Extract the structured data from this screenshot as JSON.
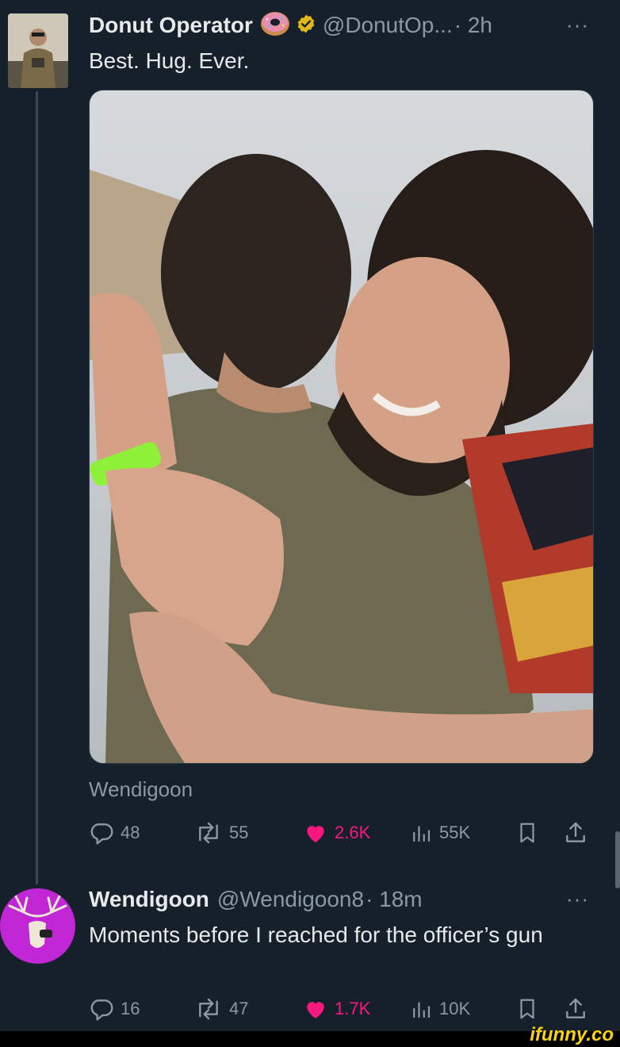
{
  "tweet1": {
    "display_name": "Donut Operator",
    "name_emoji": "donut-icon",
    "verified": true,
    "handle": "@DonutOp...",
    "time": "· 2h",
    "more": "···",
    "text": "Best. Hug. Ever.",
    "media_credit": "Wendigoon",
    "stats": {
      "replies": "48",
      "retweets": "55",
      "likes": "2.6K",
      "views": "55K"
    },
    "liked": true
  },
  "tweet2": {
    "display_name": "Wendigoon",
    "handle": "@Wendigoon8",
    "time": "· 18m",
    "more": "···",
    "text": "Moments before I reached for the officer’s gun",
    "stats": {
      "replies": "16",
      "retweets": "47",
      "likes": "1.7K",
      "views": "10K"
    },
    "liked": true
  },
  "colors": {
    "background": "#15202b",
    "like_pink": "#f91880",
    "muted": "#8b98a5",
    "verified_gold": "#e2b719",
    "avatar_purple": "#c026d3"
  },
  "watermark": "ifunny.co"
}
